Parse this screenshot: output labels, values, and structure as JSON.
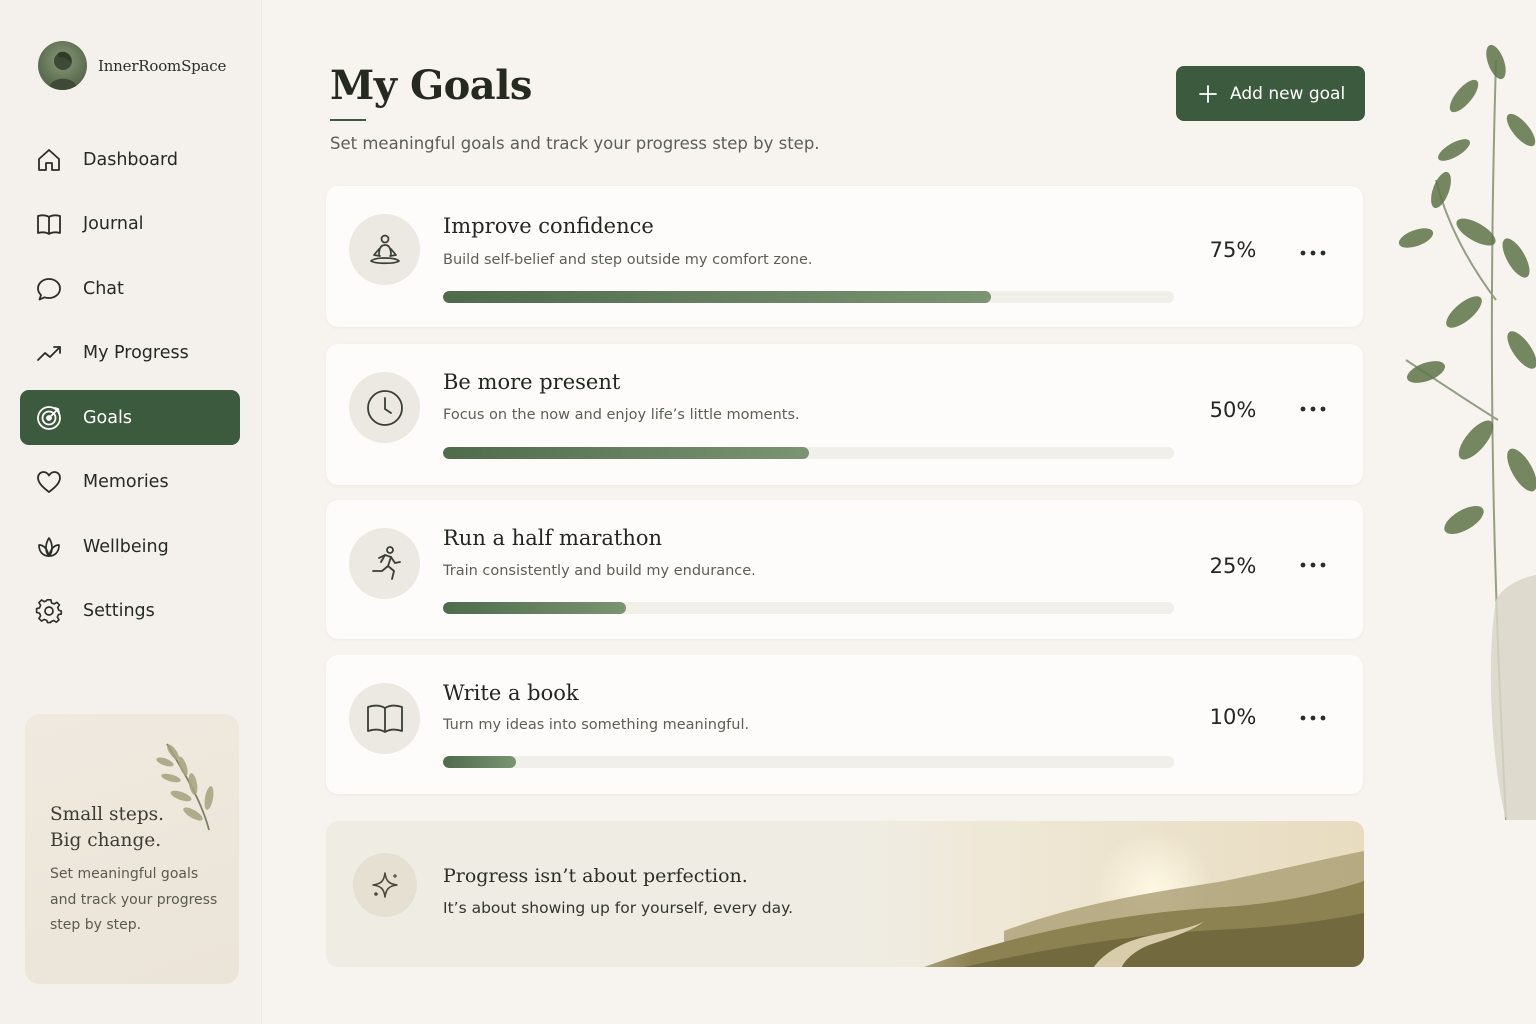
{
  "brand": {
    "name": "InnerRoomSpace"
  },
  "sidebar": {
    "items": [
      {
        "label": "Dashboard",
        "icon": "home-icon",
        "active": false
      },
      {
        "label": "Journal",
        "icon": "book-icon",
        "active": false
      },
      {
        "label": "Chat",
        "icon": "chat-icon",
        "active": false
      },
      {
        "label": "My Progress",
        "icon": "trend-up-icon",
        "active": false
      },
      {
        "label": "Goals",
        "icon": "target-icon",
        "active": true
      },
      {
        "label": "Memories",
        "icon": "heart-icon",
        "active": false
      },
      {
        "label": "Wellbeing",
        "icon": "lotus-icon",
        "active": false
      },
      {
        "label": "Settings",
        "icon": "gear-icon",
        "active": false
      }
    ],
    "quote_card": {
      "title": "Small steps.\nBig change.",
      "body": "Set meaningful goals and track your progress step by step."
    }
  },
  "header": {
    "title": "My Goals",
    "subtitle": "Set meaningful goals and track your progress step by step.",
    "add_button_label": "Add new goal"
  },
  "goals": [
    {
      "title": "Improve confidence",
      "description": "Build self-belief and step outside my comfort zone.",
      "progress": 0.75,
      "progress_label": "75%",
      "icon": "meditation-icon"
    },
    {
      "title": "Be more present",
      "description": "Focus on the now and enjoy life’s little moments.",
      "progress": 0.5,
      "progress_label": "50%",
      "icon": "clock-icon"
    },
    {
      "title": "Run a half marathon",
      "description": "Train consistently and build my endurance.",
      "progress": 0.25,
      "progress_label": "25%",
      "icon": "runner-icon"
    },
    {
      "title": "Write a book",
      "description": "Turn my ideas into something meaningful.",
      "progress": 0.1,
      "progress_label": "10%",
      "icon": "open-book-icon"
    }
  ],
  "inspiration": {
    "title": "Progress isn’t about perfection.",
    "body": "It’s about showing up for yourself, every day.",
    "icon": "sparkle-icon"
  },
  "colors": {
    "accent": "#3c5a3d",
    "background": "#f7f4ef",
    "progress_start": "#4f6b4c",
    "progress_end": "#7b9472"
  }
}
